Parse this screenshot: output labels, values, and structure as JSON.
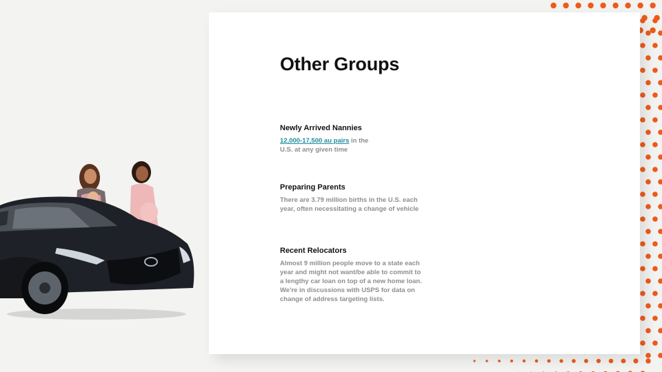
{
  "slide": {
    "title": "Other Groups",
    "groups": [
      {
        "heading": "Newly Arrived Nannies",
        "link_text": "12,000-17,500 au pairs",
        "text_after_link": " in the U.S. at any given time"
      },
      {
        "heading": "Preparing Parents",
        "body": "There are 3.79 million births in the U.S. each year, often necessitating a change of vehicle"
      },
      {
        "heading": "Recent Relocators",
        "body": "Almost 9 million people move to a state each year and might not want/be able to commit to a lengthy car loan on top of a new home loan. We're in discussions with USPS for data on change of address targeting lists."
      }
    ]
  },
  "colors": {
    "background": "#f3f3f1",
    "card": "#ffffff",
    "accent_dots": "#ee5a1a",
    "link": "#1e8d9e",
    "car_body": "#1e2128"
  },
  "images": {
    "hero": "black-sedan-with-two-women-icon"
  }
}
